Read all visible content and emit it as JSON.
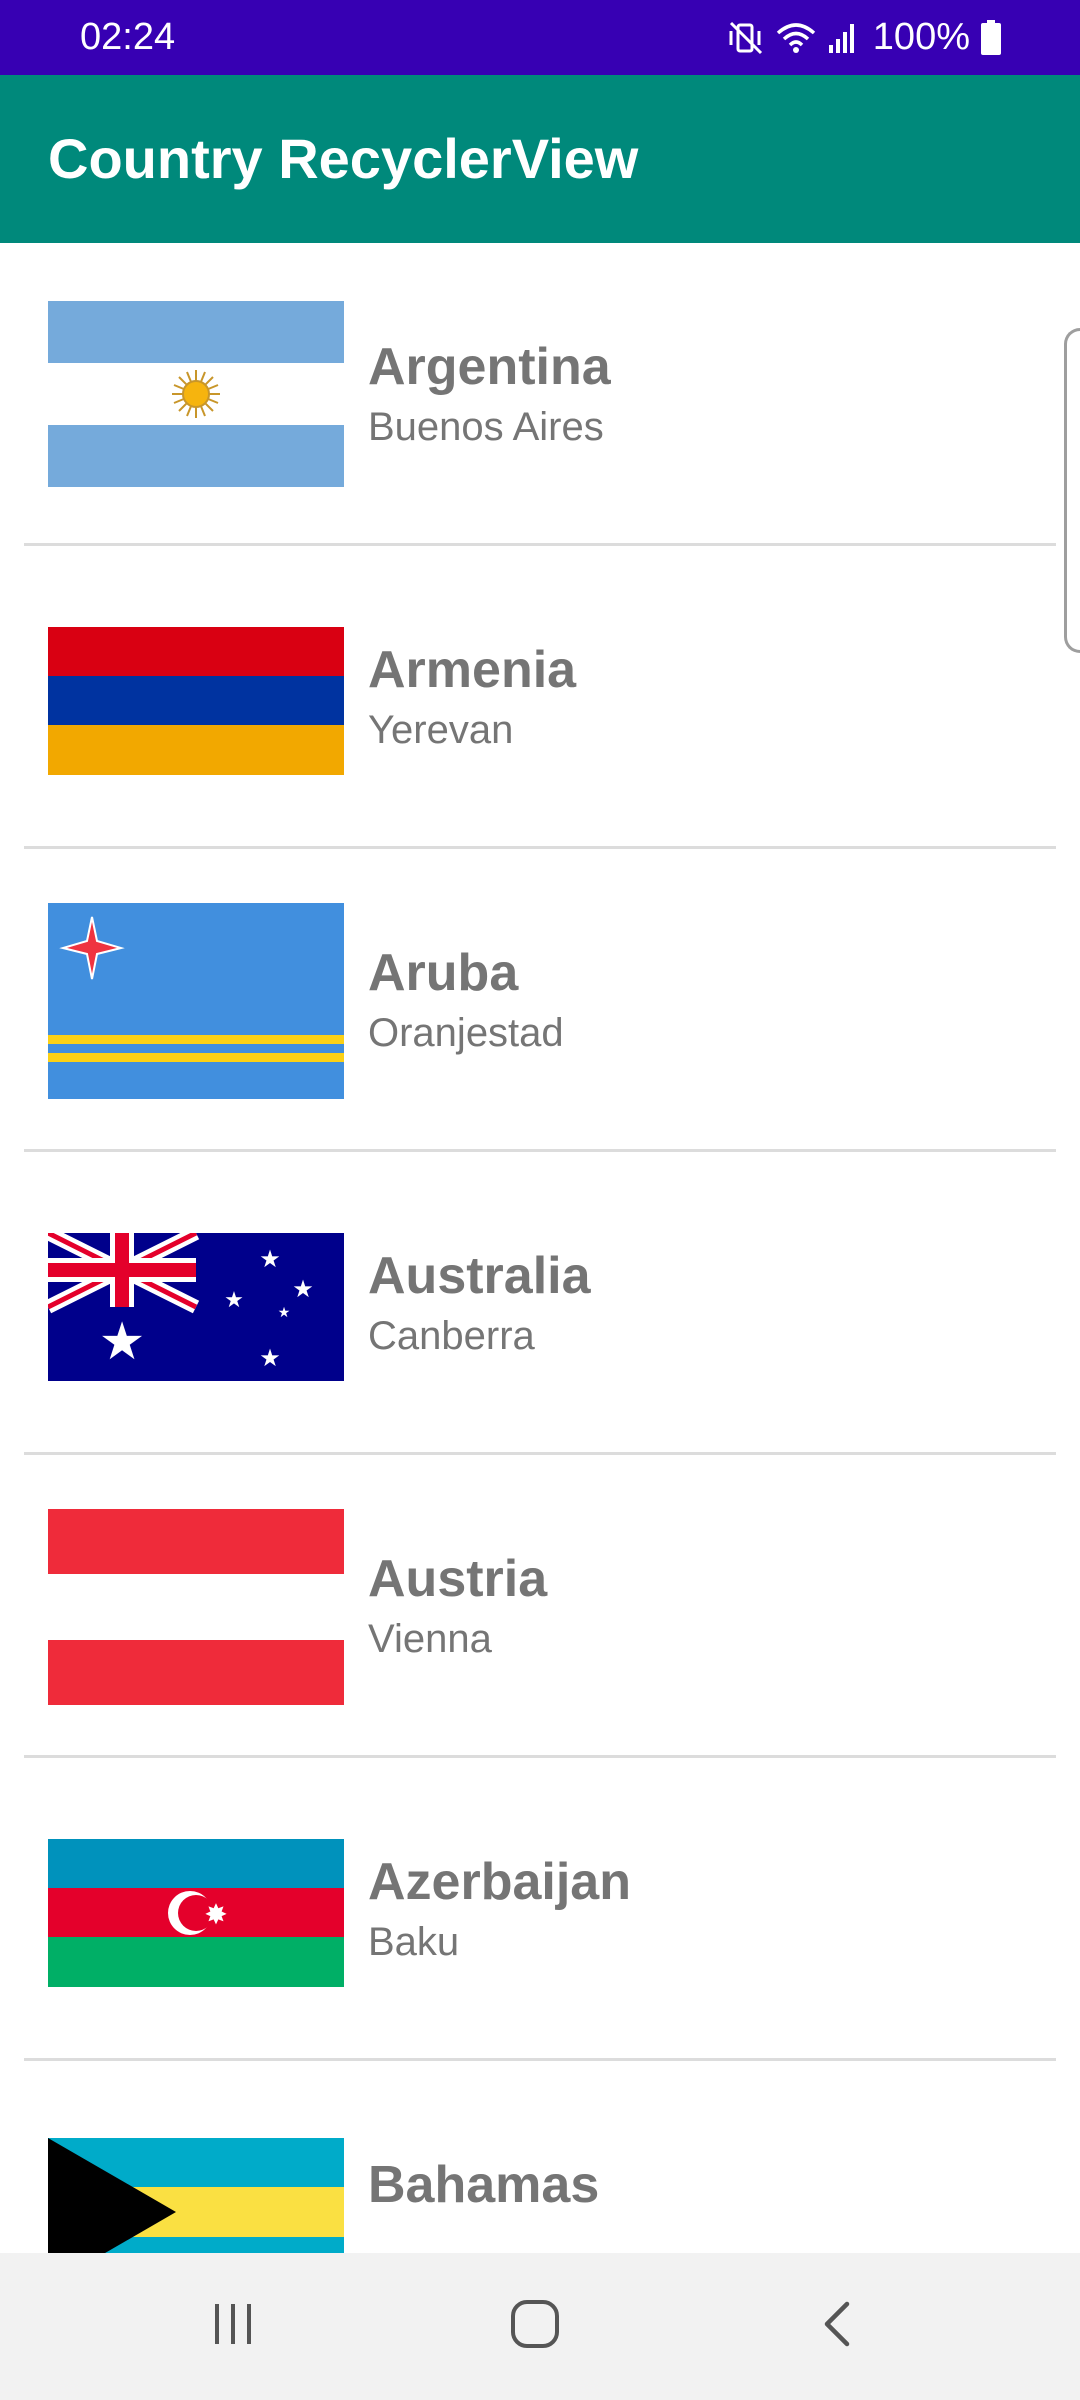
{
  "status_bar": {
    "time": "02:24",
    "battery": "100%",
    "icons": [
      "mute-vibrate-icon",
      "wifi-icon",
      "signal-icon",
      "battery-icon"
    ],
    "background": "#3700b3"
  },
  "app_bar": {
    "title": "Country RecyclerView",
    "background": "#00897b"
  },
  "countries": [
    {
      "name": "Argentina",
      "capital": "Buenos Aires",
      "flag": "argentina-flag-icon"
    },
    {
      "name": "Armenia",
      "capital": "Yerevan",
      "flag": "armenia-flag-icon"
    },
    {
      "name": "Aruba",
      "capital": "Oranjestad",
      "flag": "aruba-flag-icon"
    },
    {
      "name": "Australia",
      "capital": "Canberra",
      "flag": "australia-flag-icon"
    },
    {
      "name": "Austria",
      "capital": "Vienna",
      "flag": "austria-flag-icon"
    },
    {
      "name": "Azerbaijan",
      "capital": "Baku",
      "flag": "azerbaijan-flag-icon"
    },
    {
      "name": "Bahamas",
      "capital": "",
      "flag": "bahamas-flag-icon"
    }
  ],
  "nav_bar": {
    "buttons": [
      "recent-apps-icon",
      "home-icon",
      "back-icon"
    ]
  }
}
